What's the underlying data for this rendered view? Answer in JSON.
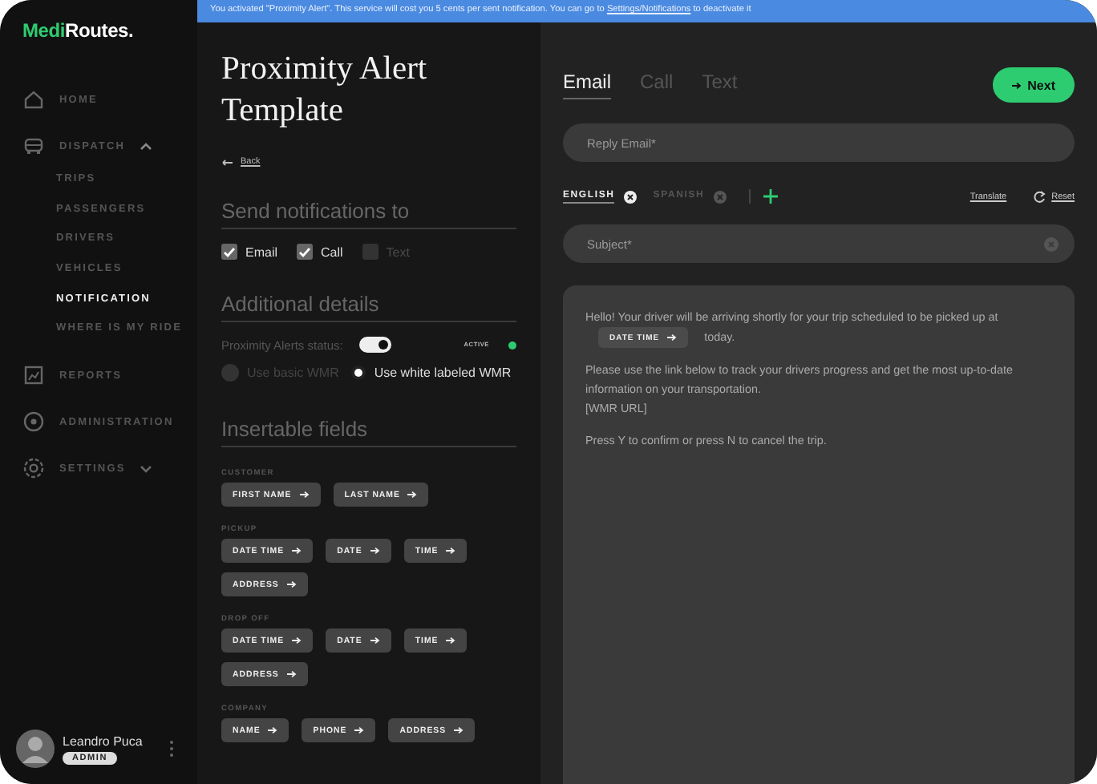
{
  "logo": {
    "part_1": "Medi",
    "part_2": "Routes."
  },
  "sidebar": {
    "items": [
      {
        "label": "HOME",
        "selected": false
      },
      {
        "label": "DISPATCH",
        "selected": false,
        "expanded": true,
        "children": [
          {
            "label": "TRIPS",
            "selected": false
          },
          {
            "label": "PASSENGERS",
            "selected": false
          },
          {
            "label": "DRIVERS",
            "selected": false
          },
          {
            "label": "VEHICLES",
            "selected": false
          },
          {
            "label": "NOTIFICATION",
            "selected": true
          },
          {
            "label": "WHERE IS MY RIDE",
            "selected": false
          }
        ]
      },
      {
        "label": "REPORTS",
        "selected": false
      },
      {
        "label": "ADMINISTRATION",
        "selected": false
      },
      {
        "label": "SETTINGS",
        "selected": false,
        "expanded": false
      }
    ]
  },
  "user": {
    "name": "Leandro Puca",
    "role": "ADMIN"
  },
  "banner": {
    "text_before": "You activated \"Proximity Alert\". This service will cost you 5 cents per sent notification. You can go to ",
    "link": "Settings/Notifications",
    "text_after": " to deactivate it"
  },
  "form": {
    "title": "Proximity Alert Template",
    "back": "Back",
    "notify": {
      "heading": "Send notifications to",
      "options": [
        {
          "label": "Email",
          "checked": true,
          "disabled": false
        },
        {
          "label": "Call",
          "checked": true,
          "disabled": false
        },
        {
          "label": "Text",
          "checked": false,
          "disabled": true
        }
      ]
    },
    "details": {
      "heading": "Additional details",
      "status_label": "Proximity Alerts status:",
      "toggle_on": true,
      "status_badge": "ACTIVE",
      "radios": [
        {
          "label": "Use basic WMR",
          "selected": false,
          "disabled": true
        },
        {
          "label": "Use white labeled WMR",
          "selected": true,
          "disabled": false
        }
      ]
    },
    "fields": {
      "heading": "Insertable fields",
      "groups": [
        {
          "label": "CUSTOMER",
          "chips": [
            "FIRST NAME",
            "LAST NAME"
          ]
        },
        {
          "label": "PICKUP",
          "chips": [
            "DATE TIME",
            "DATE",
            "TIME",
            "ADDRESS"
          ]
        },
        {
          "label": "DROP OFF",
          "chips": [
            "DATE TIME",
            "DATE",
            "TIME",
            "ADDRESS"
          ]
        },
        {
          "label": "COMPANY",
          "chips": [
            "NAME",
            "PHONE",
            "ADDRESS"
          ]
        }
      ]
    }
  },
  "editor": {
    "tabs": [
      {
        "label": "Email",
        "selected": true
      },
      {
        "label": "Call",
        "selected": false
      },
      {
        "label": "Text",
        "selected": false
      }
    ],
    "next": "Next",
    "reply_placeholder": "Reply Email*",
    "languages": [
      {
        "label": "ENGLISH",
        "selected": true
      },
      {
        "label": "SPANISH",
        "selected": false
      }
    ],
    "translate": "Translate",
    "reset": "Reset",
    "subject_placeholder": "Subject*",
    "paragraphs": [
      {
        "parts": [
          {
            "kind": "text",
            "text": "Hello! Your driver will be arriving shortly for your trip scheduled to be picked up at"
          },
          {
            "kind": "chip",
            "text": "DATE TIME"
          },
          {
            "kind": "text",
            "text": "today."
          }
        ]
      },
      {
        "parts": [
          {
            "kind": "text",
            "text": "Please use the link below to track your drivers progress and get the most up-to-date information on your transportation."
          },
          {
            "kind": "line",
            "text": "[WMR URL]"
          }
        ]
      },
      {
        "parts": [
          {
            "kind": "text",
            "text": "Press Y to confirm or press N to cancel the trip."
          }
        ]
      }
    ]
  }
}
